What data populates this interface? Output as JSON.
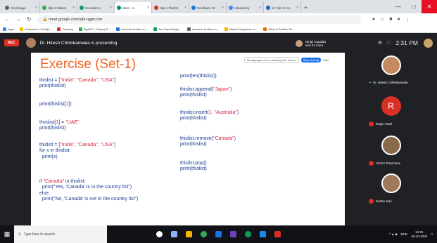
{
  "browser": {
    "tabs": [
      {
        "label": "Gerdrauge",
        "color": "#5f6368"
      },
      {
        "label": "Slip 2 Statisti",
        "color": "#34a853"
      },
      {
        "label": "Cursstat to",
        "color": "#0f9d58"
      },
      {
        "label": "Meet - ic",
        "color": "#00897b",
        "active": true
      },
      {
        "label": "Slip 1 Flashtr",
        "color": "#d93025"
      },
      {
        "label": "Feedback Gr",
        "color": "#1a73e8"
      },
      {
        "label": "relaxtioncy",
        "color": "#4285f4"
      },
      {
        "label": "12 Tips to Co",
        "color": "#1565c0"
      }
    ],
    "new_tab": "+",
    "url": "meet.google.com/xjbi-rggm-mrr",
    "bookmarks": [
      "Apps",
      "A Measure of Subje...",
      "Tracking",
      "PgcNET - Deploy R...",
      "research studies on...",
      "The Psychologic...",
      "research studies on...",
      "Master Sargenzei on...",
      "What is Positive Ps..."
    ]
  },
  "meet": {
    "rec_label": "REC",
    "presenting_text": "Dr. Hitesh Chhinkanwala is presenting",
    "joiner": {
      "name": "Ninali Kopadia",
      "sub": "and 22 more"
    },
    "toast": {
      "chip": "Meetgoogle.com is sharing your screen",
      "button": "Stop sharing",
      "hide": "Hide"
    },
    "time": "2:31 PM",
    "participants": [
      {
        "name": "Dr. Hitesh Chhinkanwala",
        "muted": false
      },
      {
        "name": "Rajan Patel",
        "initial": "R",
        "muted": true
      },
      {
        "name": "VICKY PANCHAL",
        "muted": true
      },
      {
        "name": "Sneha Jani",
        "muted": true
      }
    ]
  },
  "slide": {
    "title": "Exercise (Set-1)",
    "left_blocks": [
      [
        "thislist = [",
        "\"India\", \"Canada\", \"USA\"",
        "]",
        "print(thislist)"
      ],
      [
        "print(thislist[",
        "1",
        "])"
      ],
      [
        "thvslist[",
        "1",
        "] = ",
        "\"UAE\"",
        "print(thislist)"
      ],
      [
        "thislist = [",
        "\"India\", \"Canada\", \"USA\"",
        "]",
        "for x in thislist:",
        "  print(x)"
      ],
      [
        "if ",
        "\"Canada\"",
        " in thislist:",
        "  print(\"Yes, 'Canada' is in the country list\")",
        "else:",
        "  print(\"No, 'Canada' is not in the country list\")"
      ]
    ],
    "right_blocks": [
      [
        "print(len(thislist))"
      ],
      [
        "thislist.append(",
        "\"Japan\"",
        ")",
        "print(thislist)"
      ],
      [
        "thislist.insert(",
        "1, \"Australia\"",
        ")",
        "print(thislist)"
      ],
      [
        "thislist.remove(",
        "\"Canada\"",
        ")",
        "print(thislist)"
      ],
      [
        "thislist.pop()",
        "print(thislist)"
      ]
    ]
  },
  "taskbar": {
    "search_placeholder": "Type here to search",
    "time": "14:31",
    "date": "26-10-2020",
    "lang": "ENG"
  }
}
